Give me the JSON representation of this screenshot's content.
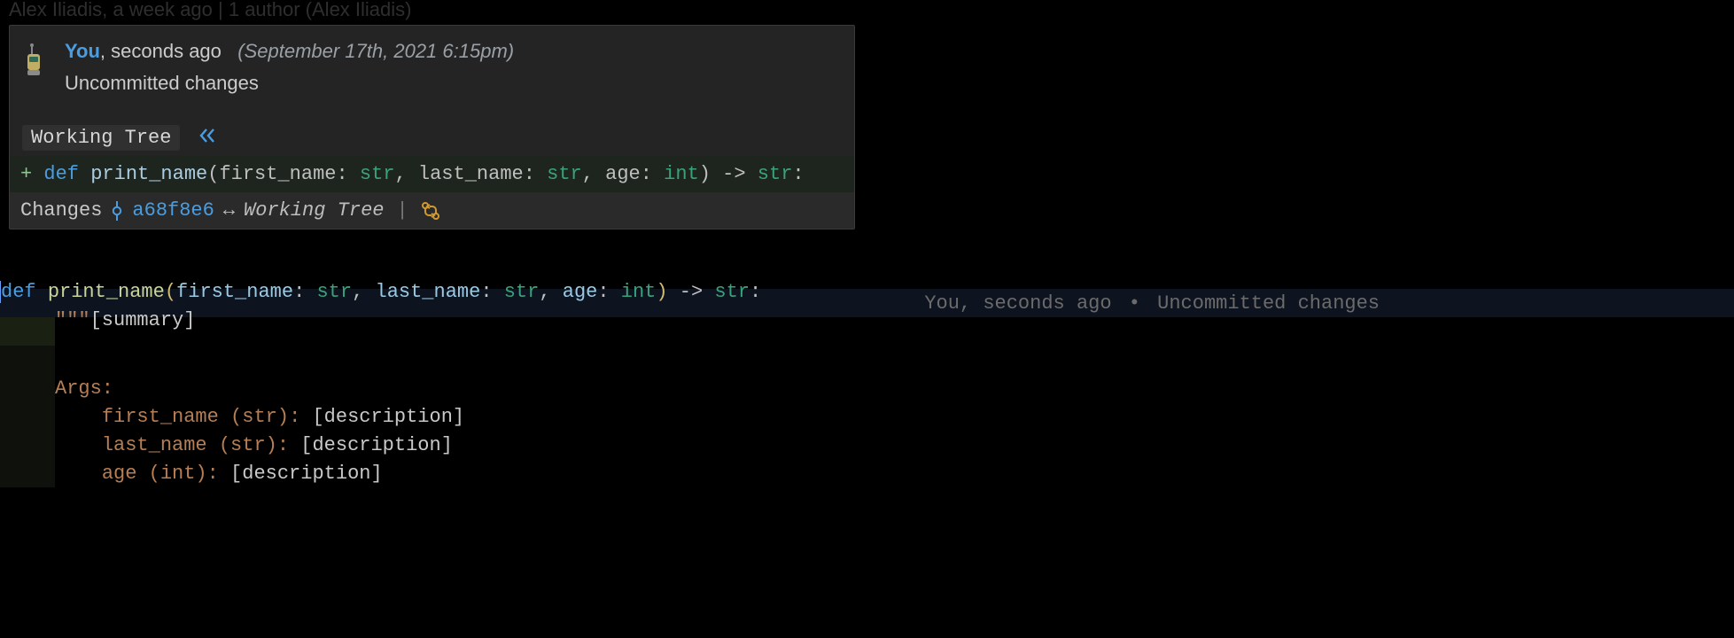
{
  "blame_behind": "Alex Iliadis, a week ago | 1 author (Alex Iliadis)",
  "popup": {
    "author": "You",
    "time_rel": ", seconds ago",
    "timestamp": "(September 17th, 2021 6:15pm)",
    "message": "Uncommitted changes",
    "working_tree_tag": "Working Tree",
    "diff": {
      "plus": "+ ",
      "def": "def ",
      "func": "print_name",
      "lp": "(",
      "p1": "first_name",
      "p2": "last_name",
      "p3": "age",
      "t1": "str",
      "t2": "str",
      "t3": "int",
      "ret": "str",
      "rp": ")",
      "arrow": " -> ",
      "colon": ":",
      "sep1": ": ",
      "comma": ", "
    },
    "changes_label": "Changes",
    "hash": "a68f8e6",
    "arrow_lr": "↔",
    "wt_italic": "Working Tree",
    "pipe": "|"
  },
  "editor": {
    "line1": {
      "def": "def ",
      "func": "print_name",
      "p1": "first_name",
      "p2": "last_name",
      "p3": "age",
      "t1": "str",
      "t2": "str",
      "t3": "int",
      "ret": "str"
    },
    "blame_inline_author": "You, seconds ago",
    "blame_inline_dot": "•",
    "blame_inline_msg": "Uncommitted changes",
    "line2_quote": "\"\"\"",
    "line2_summary": "[summary]",
    "line_args": "Args:",
    "doc_p1_name": "first_name ",
    "doc_p2_name": "last_name ",
    "doc_p3_name": "age ",
    "doc_t1": "(str)",
    "doc_t2": "(str)",
    "doc_t3": "(int)",
    "doc_colon": ": ",
    "doc_desc": "[description]"
  }
}
